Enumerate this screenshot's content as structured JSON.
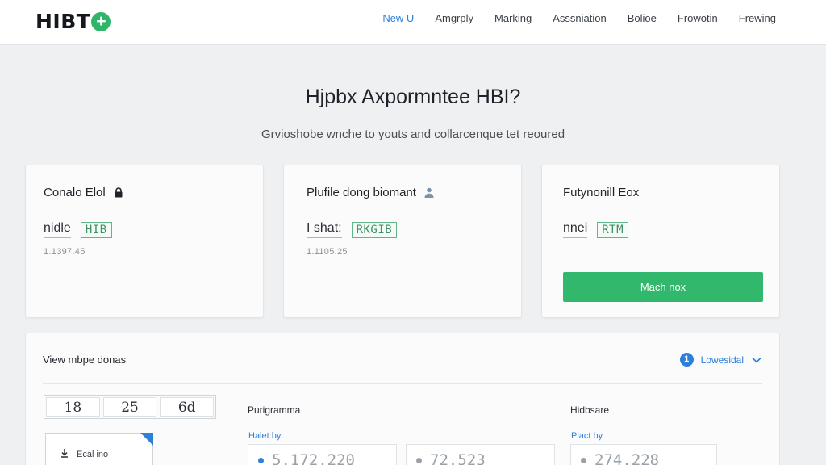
{
  "header": {
    "logo_text": "HIBT",
    "logo_plus": "+",
    "nav": [
      "New U",
      "Amgrply",
      "Marking",
      "Asssniation",
      "Bolioe",
      "Frowotin",
      "Frewing"
    ],
    "active_index": 0,
    "accent_color": "#2d7fd8"
  },
  "hero": {
    "title": "Hjpbx Axpormntee HBI?",
    "subtitle": "Grvioshobe wnche to youts and collarcenque tet reoured"
  },
  "cards": [
    {
      "title": "Conalo Elol",
      "icon": "lock-icon",
      "field_label": "nidle",
      "code": "HIB",
      "value": "1.1397.45"
    },
    {
      "title": "Plufile dong biomant",
      "icon": "user-icon",
      "field_label": "I shat:",
      "code": "RKGIB",
      "value": "1.1105.25"
    },
    {
      "title": "Futynonill Eox",
      "field_label": "nnei",
      "code": "RTM",
      "button_label": "Mach nox",
      "button_color": "#31b86c"
    }
  ],
  "panel": {
    "title": "View mbpe donas",
    "select": {
      "badge": "1",
      "label": "Lowesidal",
      "icon": "chevron-down-icon"
    },
    "stats": [
      "18",
      "25",
      "6d"
    ],
    "file": {
      "label": "Ecal ino",
      "icon": "download-icon"
    },
    "columns": [
      {
        "title": "Purigramma",
        "field_label": "Halet by",
        "values": [
          "5.172.220",
          "72.523"
        ]
      },
      {
        "title": "Hidbsare",
        "field_label": "Plact by",
        "values": [
          "274.228"
        ]
      }
    ]
  }
}
